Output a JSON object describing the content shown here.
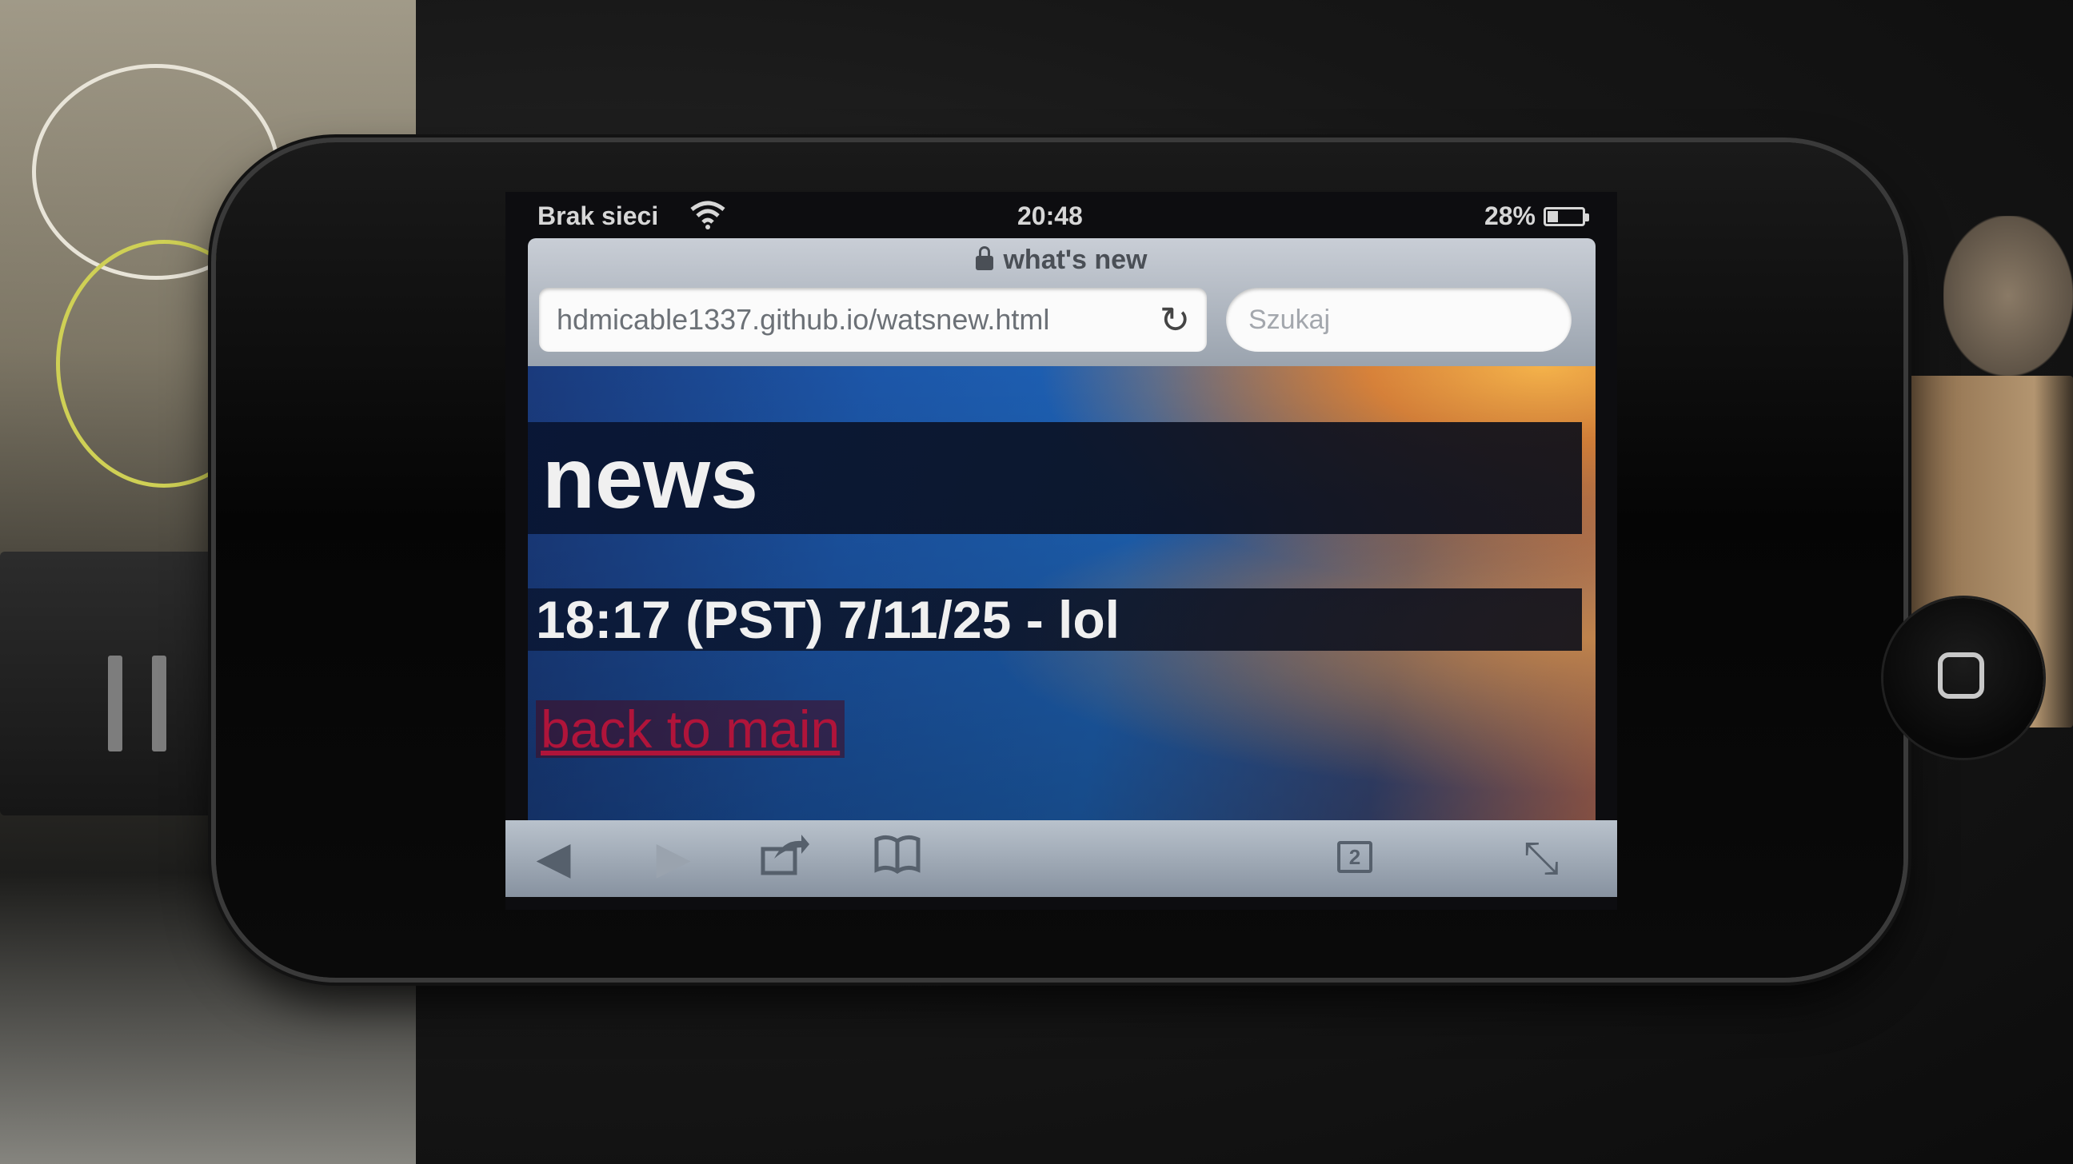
{
  "status_bar": {
    "carrier": "Brak sieci",
    "time": "20:48",
    "battery": "28%",
    "battery_level": 0.28
  },
  "browser": {
    "page_title": "what's new",
    "url": "hdmicable1337.github.io/watsnew.html",
    "search_placeholder": "Szukaj",
    "tabs_count": "2"
  },
  "page": {
    "heading": "news",
    "posts": [
      "18:17 (PST) 7/11/25 - lol"
    ],
    "back_link": "back to main"
  },
  "colors": {
    "link": "#b0143a",
    "background_blue": "#1c56a8",
    "toolbar": "#9aa3ae"
  },
  "icons": [
    "wifi-icon",
    "lock-icon",
    "reload-icon",
    "back-arrow-icon",
    "forward-arrow-icon",
    "share-icon",
    "bookmarks-icon",
    "tabs-icon",
    "fullscreen-icon",
    "home-button-icon",
    "battery-icon"
  ]
}
